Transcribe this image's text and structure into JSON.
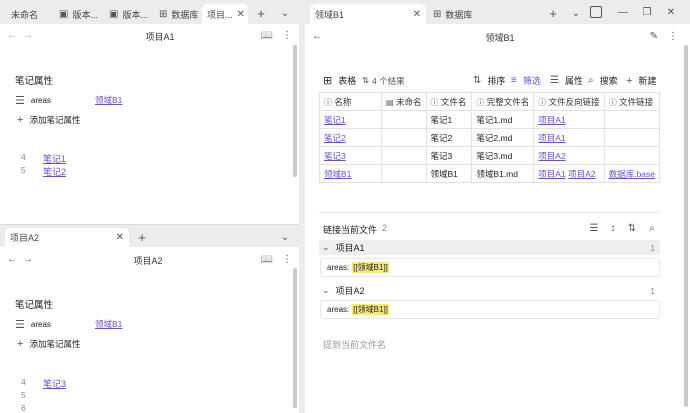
{
  "left": {
    "tabs": [
      {
        "label": "未命名",
        "icon": "none"
      },
      {
        "label": "版本...",
        "icon": "doc-icon"
      },
      {
        "label": "版本...",
        "icon": "doc-icon"
      },
      {
        "label": "数据库",
        "icon": "table-icon"
      },
      {
        "label": "项目...",
        "icon": "none"
      }
    ],
    "top_pane": {
      "title": "项目A1",
      "props_heading": "笔记属性",
      "prop_key": "areas",
      "prop_value": "领域B1",
      "add_prop": "添加笔记属性",
      "lines": [
        {
          "num": "4",
          "text": "笔记1"
        },
        {
          "num": "5",
          "text": "笔记2"
        }
      ]
    },
    "bottom_pane": {
      "tab_label": "项目A2",
      "title": "项目A2",
      "props_heading": "笔记属性",
      "prop_key": "areas",
      "prop_value": "领域B1",
      "add_prop": "添加笔记属性",
      "lines": [
        {
          "num": "4",
          "text": "笔记3"
        },
        {
          "num": "5",
          "text": ""
        },
        {
          "num": "6",
          "text": ""
        }
      ]
    }
  },
  "right": {
    "tabs": [
      {
        "label": "领域B1",
        "icon": "none"
      },
      {
        "label": "数据库",
        "icon": "table-icon"
      }
    ],
    "title": "领域B1",
    "base": {
      "view_label": "表格",
      "results": "4 个结果",
      "sort": "排序",
      "filter": "筛选",
      "props": "属性",
      "search": "搜索",
      "new": "新建",
      "columns": [
        "名称",
        "未命名",
        "文件名",
        "完整文件名",
        "文件反向链接",
        "文件链接"
      ],
      "rows": [
        {
          "name": "笔记1",
          "unnamed": "",
          "file": "笔记1",
          "full": "笔记1.md",
          "backlinks": [
            "项目A1"
          ],
          "links": []
        },
        {
          "name": "笔记2",
          "unnamed": "",
          "file": "笔记2",
          "full": "笔记2.md",
          "backlinks": [
            "项目A1"
          ],
          "links": []
        },
        {
          "name": "笔记3",
          "unnamed": "",
          "file": "笔记3",
          "full": "笔记3.md",
          "backlinks": [
            "项目A2"
          ],
          "links": []
        },
        {
          "name": "领域B1",
          "unnamed": "",
          "file": "领域B1",
          "full": "领域B1.md",
          "backlinks": [
            "项目A1",
            "项目A2"
          ],
          "links": [
            "数据库.base"
          ]
        }
      ]
    },
    "backlinks": {
      "title": "链接当前文件",
      "count": "2",
      "groups": [
        {
          "name": "项目A1",
          "count": "1",
          "line_key": "areas:",
          "line_value": "[[领域B1]]"
        },
        {
          "name": "项目A2",
          "count": "1",
          "line_key": "areas:",
          "line_value": "[[领域B1]]"
        }
      ],
      "unlinked": "提到当前文件名"
    }
  }
}
